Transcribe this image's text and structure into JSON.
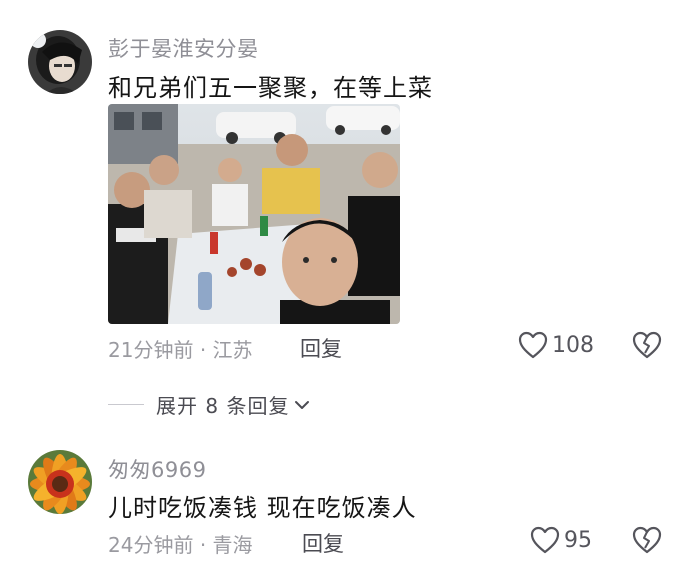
{
  "comments": [
    {
      "username": "彭于晏淮安分晏",
      "text": "和兄弟们五一聚聚，在等上菜",
      "has_photo": true,
      "time": "21分钟前",
      "location": "江苏",
      "reply_label": "回复",
      "likes": "108"
    },
    {
      "username": "匆匆6969",
      "text": "儿时吃饭凑钱  现在吃饭凑人",
      "has_photo": false,
      "time": "24分钟前",
      "location": "青海",
      "reply_label": "回复",
      "likes": "95"
    }
  ],
  "expand_replies": {
    "label": "展开 8 条回复"
  },
  "separator": "·",
  "icons": {
    "like": "heart-outline-icon",
    "dislike": "broken-heart-icon",
    "expand": "chevron-down-icon"
  },
  "colors": {
    "username": "#8f8f96",
    "meta": "#9a9aa0",
    "text": "#151515",
    "icon": "#55555c"
  }
}
